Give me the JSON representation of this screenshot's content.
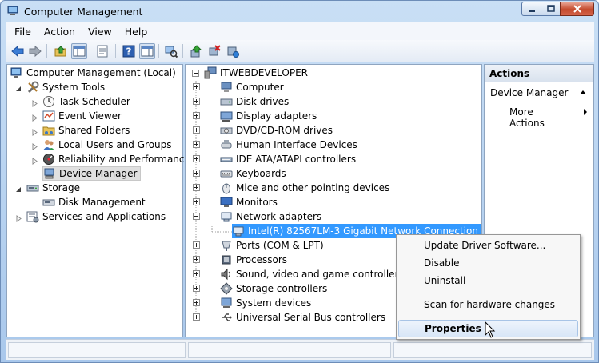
{
  "window": {
    "title": "Computer Management"
  },
  "menu": [
    "File",
    "Action",
    "View",
    "Help"
  ],
  "toolbar": {
    "icons": [
      "back-arrow-icon",
      "forward-arrow-icon",
      "up-folder-icon",
      "show-hide-tree-icon",
      "properties-sheet-icon",
      "help-icon",
      "show-hide-action-pane-icon",
      "scan-hardware-icon",
      "update-driver-icon",
      "uninstall-device-icon",
      "enable-device-icon"
    ]
  },
  "left_tree": {
    "root": "Computer Management (Local)",
    "system_tools": "System Tools",
    "task_scheduler": "Task Scheduler",
    "event_viewer": "Event Viewer",
    "shared_folders": "Shared Folders",
    "local_users": "Local Users and Groups",
    "reliability": "Reliability and Performance",
    "device_manager": "Device Manager",
    "storage": "Storage",
    "disk_management": "Disk Management",
    "services": "Services and Applications"
  },
  "device_tree": {
    "root": "ITWEBDEVELOPER",
    "categories": [
      "Computer",
      "Disk drives",
      "Display adapters",
      "DVD/CD-ROM drives",
      "Human Interface Devices",
      "IDE ATA/ATAPI controllers",
      "Keyboards",
      "Mice and other pointing devices",
      "Monitors",
      "Network adapters"
    ],
    "selected_device": "Intel(R) 82567LM-3 Gigabit Network Connection",
    "categories_after": [
      "Ports (COM & LPT)",
      "Processors",
      "Sound, video and game controllers",
      "Storage controllers",
      "System devices",
      "Universal Serial Bus controllers"
    ]
  },
  "actions": {
    "header": "Actions",
    "section": "Device Manager",
    "more": "More Actions"
  },
  "context_menu": {
    "update": "Update Driver Software...",
    "disable": "Disable",
    "uninstall": "Uninstall",
    "scan": "Scan for hardware changes",
    "properties": "Properties"
  },
  "colors": {
    "selection": "#3399ff",
    "window_frame": "#a9c8ec"
  }
}
